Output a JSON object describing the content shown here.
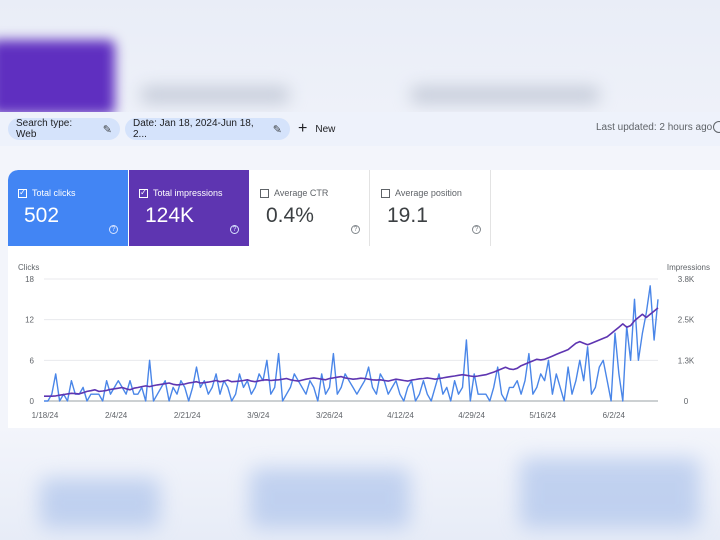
{
  "filters": {
    "search_type": "Search type: Web",
    "date": "Date: Jan 18, 2024-Jun 18, 2...",
    "new_label": "New",
    "last_updated": "Last updated: 2 hours ago"
  },
  "metrics": [
    {
      "label": "Total clicks",
      "value": "502",
      "selected": true,
      "color": "#4285f4"
    },
    {
      "label": "Total impressions",
      "value": "124K",
      "selected": true,
      "color": "#5e35b1"
    },
    {
      "label": "Average CTR",
      "value": "0.4%",
      "selected": false
    },
    {
      "label": "Average position",
      "value": "19.1",
      "selected": false
    }
  ],
  "icons": {
    "edit": "pencil-icon",
    "add": "plus-icon",
    "help": "help-circle-icon",
    "checkbox": "checkbox-icon"
  },
  "chart_data": {
    "type": "line",
    "ylabel_left": "Clicks",
    "ylabel_right": "Impressions",
    "y_left_ticks": [
      "18",
      "12",
      "6",
      "0"
    ],
    "y_left_range": [
      0,
      18
    ],
    "y_right_ticks": [
      "3.8K",
      "2.5K",
      "1.3K",
      "0"
    ],
    "y_right_range": [
      0,
      3800
    ],
    "x_ticks": [
      "1/18/24",
      "2/4/24",
      "2/21/24",
      "3/9/24",
      "3/26/24",
      "4/12/24",
      "4/29/24",
      "5/16/24",
      "6/2/24"
    ],
    "grid": true,
    "series": [
      {
        "name": "Clicks",
        "color": "#4a86e8",
        "axis": "left",
        "values": [
          0,
          0,
          1,
          4,
          0,
          1,
          0,
          3,
          1,
          1,
          2,
          0,
          1,
          1,
          1,
          0,
          3,
          1,
          2,
          3,
          2,
          1,
          3,
          1,
          1,
          2,
          0,
          6,
          0,
          1,
          2,
          3,
          0,
          2,
          1,
          3,
          2,
          0,
          2,
          5,
          2,
          3,
          1,
          2,
          4,
          1,
          3,
          2,
          0,
          1,
          4,
          2,
          3,
          1,
          2,
          4,
          3,
          6,
          1,
          2,
          7,
          0,
          1,
          2,
          4,
          3,
          2,
          1,
          3,
          2,
          0,
          4,
          1,
          2,
          7,
          1,
          2,
          4,
          3,
          2,
          1,
          2,
          3,
          5,
          2,
          1,
          4,
          3,
          1,
          2,
          3,
          1,
          0,
          2,
          3,
          0,
          1,
          3,
          1,
          0,
          2,
          4,
          1,
          2,
          0,
          3,
          1,
          2,
          9,
          0,
          4,
          1,
          1,
          1,
          0,
          2,
          5,
          1,
          0,
          2,
          2,
          3,
          1,
          3,
          7,
          1,
          2,
          4,
          3,
          6,
          1,
          4,
          2,
          0,
          5,
          1,
          3,
          6,
          3,
          8,
          1,
          2,
          5,
          6,
          3,
          0,
          10,
          4,
          0,
          11,
          6,
          15,
          6,
          10,
          13,
          17,
          9,
          15
        ]
      },
      {
        "name": "Impressions",
        "color": "#5e35b1",
        "axis": "right",
        "values": [
          150,
          150,
          150,
          160,
          180,
          200,
          220,
          240,
          230,
          220,
          260,
          300,
          320,
          350,
          300,
          310,
          330,
          360,
          380,
          400,
          420,
          380,
          350,
          400,
          420,
          450,
          470,
          450,
          480,
          500,
          520,
          540,
          560,
          520,
          500,
          510,
          530,
          560,
          580,
          600,
          560,
          570,
          590,
          610,
          640,
          600,
          620,
          650,
          600,
          610,
          620,
          640,
          660,
          620,
          600,
          630,
          650,
          660,
          640,
          650,
          660,
          680,
          700,
          660,
          640,
          620,
          650,
          680,
          700,
          720,
          700,
          680,
          660,
          700,
          720,
          740,
          760,
          720,
          700,
          680,
          690,
          710,
          700,
          680,
          660,
          650,
          660,
          640,
          620,
          650,
          680,
          660,
          640,
          620,
          650,
          670,
          690,
          700,
          720,
          700,
          680,
          700,
          720,
          740,
          760,
          780,
          800,
          820,
          800,
          780,
          760,
          780,
          800,
          820,
          860,
          900,
          950,
          1000,
          1050,
          1000,
          980,
          1020,
          1100,
          1150,
          1200,
          1250,
          1300,
          1280,
          1300,
          1350,
          1400,
          1450,
          1500,
          1550,
          1600,
          1700,
          1800,
          1850,
          1800,
          1750,
          1800,
          1850,
          1900,
          1950,
          2000,
          2100,
          2200,
          2300,
          2400,
          2300,
          2350,
          2500,
          2600,
          2700,
          2600,
          2700,
          2800,
          2900
        ]
      }
    ]
  }
}
